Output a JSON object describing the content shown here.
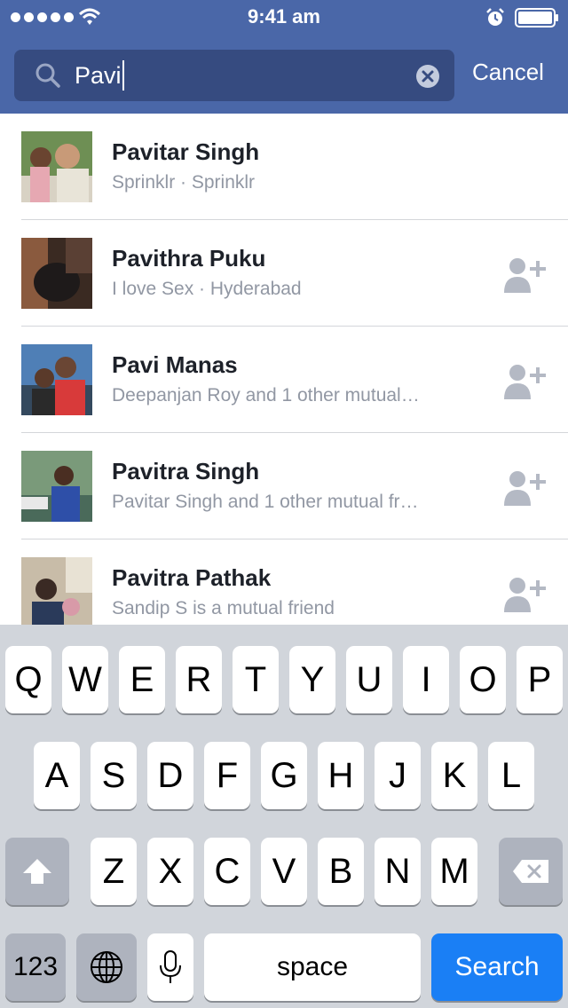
{
  "status_bar": {
    "time": "9:41 am",
    "signal_icon": "signal-dots-icon",
    "wifi_icon": "wifi-icon",
    "alarm_icon": "alarm-icon",
    "battery_icon": "battery-icon"
  },
  "search": {
    "value": "Pavi",
    "search_icon": "search-icon",
    "clear_icon": "clear-icon",
    "cancel_label": "Cancel"
  },
  "results": [
    {
      "name": "Pavitar Singh",
      "subtitle": "Sprinklr · Sprinklr",
      "show_add_friend": false
    },
    {
      "name": "Pavithra Puku",
      "subtitle": "I love Sex · Hyderabad",
      "show_add_friend": true
    },
    {
      "name": "Pavi Manas",
      "subtitle": "Deepanjan Roy and 1 other mutual…",
      "show_add_friend": true
    },
    {
      "name": "Pavitra Singh",
      "subtitle": "Pavitar Singh and 1 other mutual fr…",
      "show_add_friend": true
    },
    {
      "name": "Pavitra Pathak",
      "subtitle": "Sandip S is a mutual friend",
      "show_add_friend": true
    }
  ],
  "keyboard": {
    "row1": [
      "Q",
      "W",
      "E",
      "R",
      "T",
      "Y",
      "U",
      "I",
      "O",
      "P"
    ],
    "row2": [
      "A",
      "S",
      "D",
      "F",
      "G",
      "H",
      "J",
      "K",
      "L"
    ],
    "row3": [
      "Z",
      "X",
      "C",
      "V",
      "B",
      "N",
      "M"
    ],
    "numbers_label": "123",
    "space_label": "space",
    "search_label": "Search",
    "shift_icon": "shift-icon",
    "delete_icon": "delete-icon",
    "globe_icon": "globe-icon",
    "mic_icon": "microphone-icon"
  },
  "colors": {
    "header": "#4a67a8",
    "search_field": "#364b80",
    "search_key": "#1a7ff5"
  }
}
